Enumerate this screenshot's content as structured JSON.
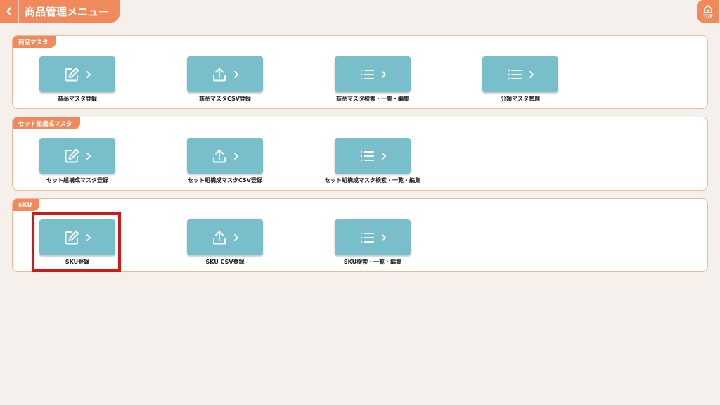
{
  "header": {
    "title": "商品管理メニュー",
    "back_icon": "chevron-left-icon"
  },
  "top_button": {
    "label": "TOP",
    "icon": "home-icon"
  },
  "colors": {
    "accent": "#f08a5d",
    "tile": "#78bfcb",
    "highlight": "#cc1a1a",
    "background": "#f5f0ec"
  },
  "sections": [
    {
      "label": "商品マスタ",
      "items": [
        {
          "label": "商品マスタ登録",
          "icon": "edit-icon"
        },
        {
          "label": "商品マスタCSV登録",
          "icon": "upload-icon"
        },
        {
          "label": "商品マスタ検索・一覧・編集",
          "icon": "list-icon"
        },
        {
          "label": "分類マスタ管理",
          "icon": "list-icon"
        }
      ]
    },
    {
      "label": "セット組構成マスタ",
      "items": [
        {
          "label": "セット組構成マスタ登録",
          "icon": "edit-icon"
        },
        {
          "label": "セット組構成マスタCSV登録",
          "icon": "upload-icon"
        },
        {
          "label": "セット組構成マスタ検索・一覧・編集",
          "icon": "list-icon"
        }
      ]
    },
    {
      "label": "SKU",
      "items": [
        {
          "label": "SKU登録",
          "icon": "edit-icon"
        },
        {
          "label": "SKU CSV登録",
          "icon": "upload-icon"
        },
        {
          "label": "SKU検索・一覧・編集",
          "icon": "list-icon"
        }
      ]
    }
  ]
}
